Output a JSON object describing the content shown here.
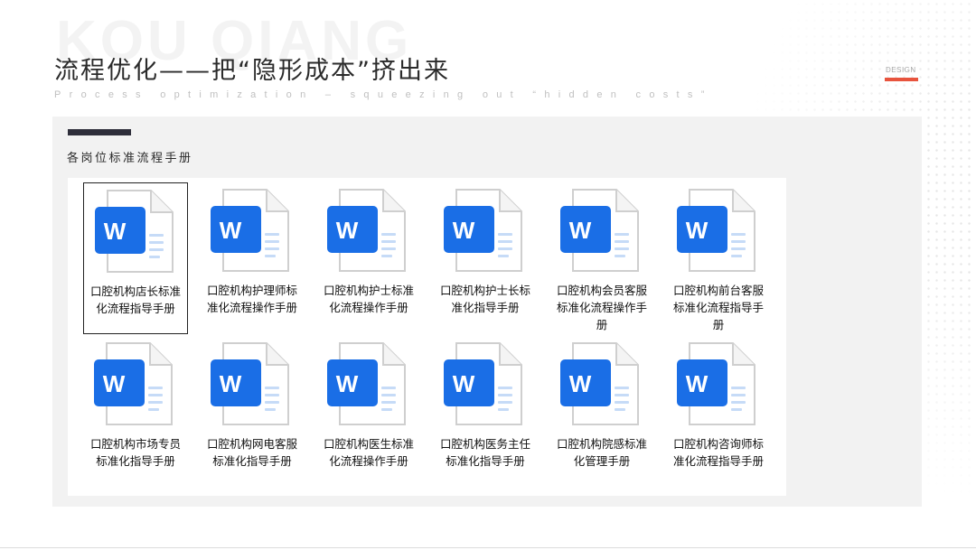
{
  "header": {
    "watermark": "KOU QIANG",
    "title": "流程优化——把“隐形成本”挤出来",
    "subtitle": "Process optimization – squeezing out “hidden costs”",
    "tag": "DESIGN"
  },
  "colors": {
    "accent": "#e8543e",
    "word_blue": "#1a6ee6",
    "panel_bg": "#f2f2f2"
  },
  "section": {
    "heading": "各岗位标准流程手册"
  },
  "files": [
    {
      "name": "口腔机构店长标准化流程指导手册",
      "icon": "word-doc-icon",
      "selected": true
    },
    {
      "name": "口腔机构护理师标准化流程操作手册",
      "icon": "word-doc-icon",
      "selected": false
    },
    {
      "name": "口腔机构护士标准化流程操作手册",
      "icon": "word-doc-icon",
      "selected": false
    },
    {
      "name": "口腔机构护士长标准化指导手册",
      "icon": "word-doc-icon",
      "selected": false
    },
    {
      "name": "口腔机构会员客服标准化流程操作手册",
      "icon": "word-doc-icon",
      "selected": false
    },
    {
      "name": "口腔机构前台客服标准化流程指导手册",
      "icon": "word-doc-icon",
      "selected": false
    },
    {
      "name": "口腔机构市场专员标准化指导手册",
      "icon": "word-doc-icon",
      "selected": false
    },
    {
      "name": "口腔机构网电客服标准化指导手册",
      "icon": "word-doc-icon",
      "selected": false
    },
    {
      "name": "口腔机构医生标准化流程操作手册",
      "icon": "word-doc-icon",
      "selected": false
    },
    {
      "name": "口腔机构医务主任标准化指导手册",
      "icon": "word-doc-icon",
      "selected": false
    },
    {
      "name": "口腔机构院感标准化管理手册",
      "icon": "word-doc-icon",
      "selected": false
    },
    {
      "name": "口腔机构咨询师标准化流程指导手册",
      "icon": "word-doc-icon",
      "selected": false
    }
  ],
  "word_letter": "W"
}
